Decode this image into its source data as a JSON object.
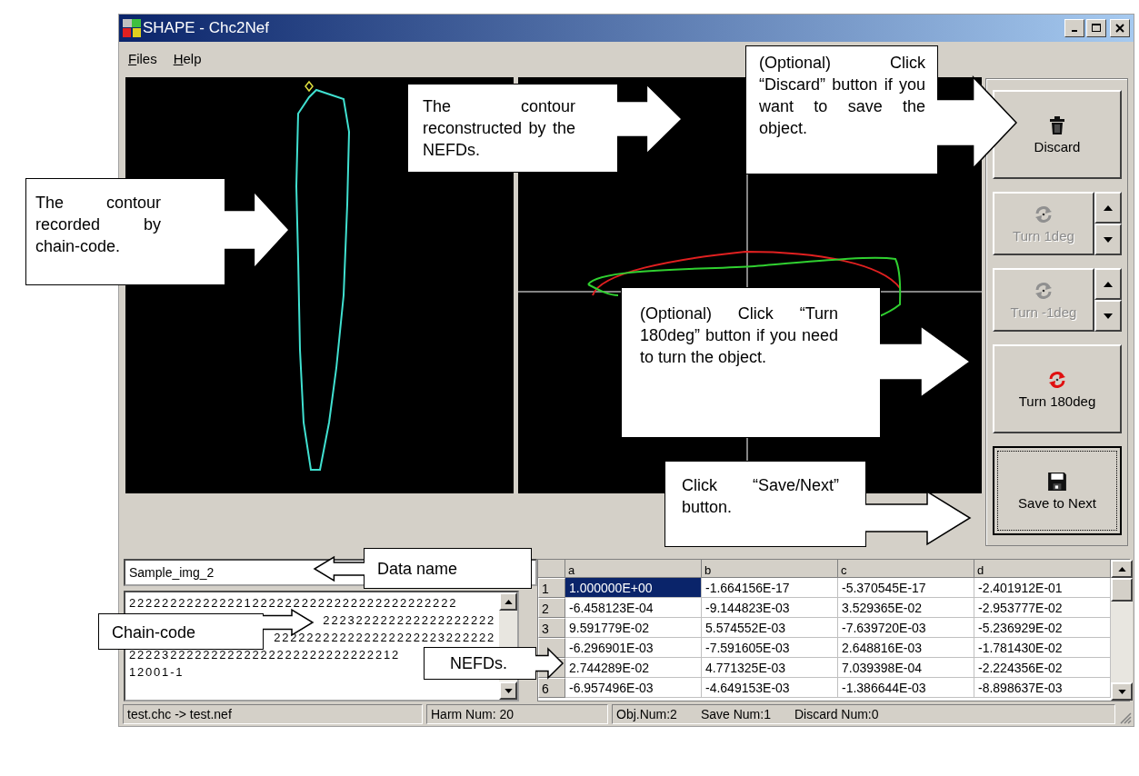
{
  "window": {
    "title": "SHAPE - Chc2Nef"
  },
  "menu": [
    "Files",
    "Help"
  ],
  "buttons": [
    {
      "kind": "discard",
      "label": "Discard",
      "disabled": false,
      "focused": false
    },
    {
      "kind": "turn-step",
      "label": "Turn 1deg",
      "disabled": true,
      "focused": false
    },
    {
      "kind": "turn-step",
      "label": "Turn -1deg",
      "disabled": true,
      "focused": false
    },
    {
      "kind": "turn-half",
      "label": "Turn 180deg",
      "disabled": false,
      "focused": false
    },
    {
      "kind": "save",
      "label": "Save to Next",
      "disabled": false,
      "focused": true
    }
  ],
  "data_name": {
    "value": "Sample_img_2"
  },
  "chain_code": {
    "lines": [
      {
        "text": "2222222222222212222222222222222222222222",
        "kind": "full"
      },
      {
        "text": "222322222222222222222",
        "kind": "covered"
      },
      {
        "text": "222222222222222222223222222",
        "kind": "covered"
      },
      {
        "text": "222232222222222222222222222222212",
        "kind": "full"
      },
      {
        "text": "12001-1",
        "kind": "full"
      }
    ]
  },
  "table": {
    "columns": [
      "a",
      "b",
      "c",
      "d"
    ],
    "rows": [
      {
        "label": "1",
        "cells": [
          {
            "text": "1.000000E+00",
            "selected": true
          },
          {
            "text": "-1.664156E-17",
            "selected": false
          },
          {
            "text": "-5.370545E-17",
            "selected": false
          },
          {
            "text": "-2.401912E-01",
            "selected": false
          }
        ]
      },
      {
        "label": "2",
        "cells": [
          {
            "text": "-6.458123E-04",
            "selected": false
          },
          {
            "text": "-9.144823E-03",
            "selected": false
          },
          {
            "text": "3.529365E-02",
            "selected": false
          },
          {
            "text": "-2.953777E-02",
            "selected": false
          }
        ]
      },
      {
        "label": "3",
        "cells": [
          {
            "text": "9.591779E-02",
            "selected": false
          },
          {
            "text": "5.574552E-03",
            "selected": false
          },
          {
            "text": "-7.639720E-03",
            "selected": false
          },
          {
            "text": "-5.236929E-02",
            "selected": false
          }
        ]
      },
      {
        "cells": [
          {
            "text": "-6.296901E-03",
            "selected": false
          },
          {
            "text": "-7.591605E-03",
            "selected": false
          },
          {
            "text": "2.648816E-03",
            "selected": false
          },
          {
            "text": "-1.781430E-02",
            "selected": false
          }
        ]
      },
      {
        "cells": [
          {
            "text": "2.744289E-02",
            "selected": false
          },
          {
            "text": "4.771325E-03",
            "selected": false
          },
          {
            "text": "7.039398E-04",
            "selected": false
          },
          {
            "text": "-2.224356E-02",
            "selected": false
          }
        ]
      },
      {
        "label": "6",
        "cells": [
          {
            "text": "-6.957496E-03",
            "selected": false
          },
          {
            "text": "-4.649153E-03",
            "selected": false
          },
          {
            "text": "-1.386644E-03",
            "selected": false
          },
          {
            "text": "-8.898637E-03",
            "selected": false
          }
        ]
      }
    ]
  },
  "status_bar": [
    {
      "parts": [
        "test.chc -> test.nef"
      ]
    },
    {
      "parts": [
        "Harm Num: 20"
      ]
    },
    {
      "parts": [
        "Obj.Num:2",
        "Save Num:1",
        "Discard Num:0"
      ]
    }
  ],
  "callouts": [
    {
      "text": "The contour recorded by chain-code."
    },
    {
      "text": "The contour reconstructed by the NEFDs."
    },
    {
      "text": "(Optional) Click “Discard” button if you want to save the object."
    },
    {
      "text": "(Optional) Click “Turn 180deg” button if you need to turn the object."
    },
    {
      "text": "Click “Save/Next” button."
    },
    {
      "text": "Data name"
    },
    {
      "text": "Chain-code"
    },
    {
      "text": "NEFDs."
    }
  ]
}
